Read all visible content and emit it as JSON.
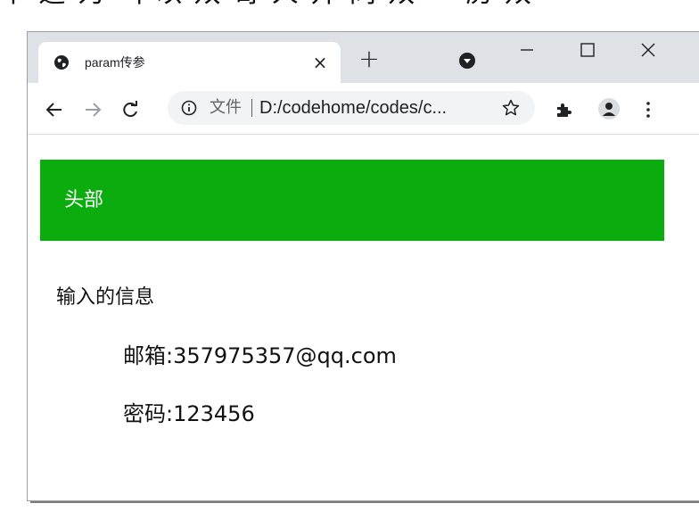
{
  "top_fragment": "中 逛 为 叫 以 双 哥 人 开 同 双 一 历 双",
  "browser": {
    "tab": {
      "title": "param传参",
      "close_glyph": "×",
      "favicon": "globe-icon"
    },
    "new_tab_glyph": "+",
    "window_controls": [
      "minimize",
      "maximize",
      "close"
    ],
    "toolbar": {
      "secure_label": "文件",
      "url": "D:/codehome/codes/c..."
    }
  },
  "page": {
    "header": {
      "text": "头部",
      "background": "#0aac0e"
    },
    "section_title": "输入的信息",
    "email": {
      "label": "邮箱:",
      "value": "357975357@qq.com"
    },
    "password": {
      "label": "密码:",
      "value": "123456"
    }
  }
}
